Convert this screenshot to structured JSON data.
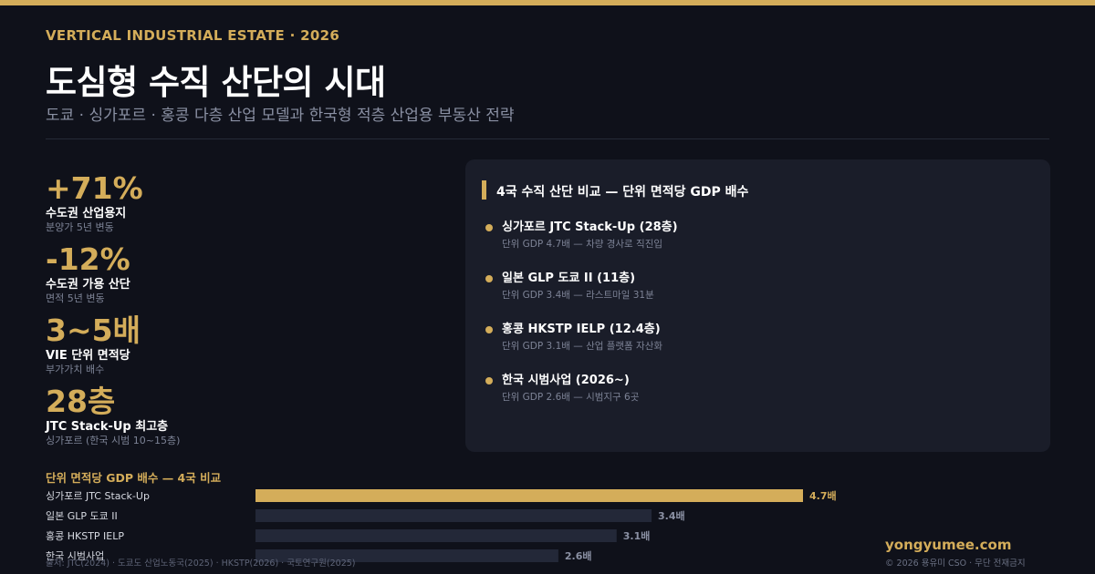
{
  "header": {
    "kicker": "VERTICAL INDUSTRIAL ESTATE · 2026",
    "title": "도심형 수직 산단의 시대",
    "subtitle": "도쿄 · 싱가포르 · 홍콩 다층 산업 모델과 한국형 적층 산업용 부동산 전략"
  },
  "stats": [
    {
      "value": "+71%",
      "label": "수도권 산업용지",
      "sub": "분양가 5년 변동"
    },
    {
      "value": "-12%",
      "label": "수도권 가용 산단",
      "sub": "면적 5년 변동"
    },
    {
      "value": "3~5배",
      "label": "VIE 단위 면적당",
      "sub": "부가가치 배수"
    },
    {
      "value": "28층",
      "label": "JTC Stack-Up 최고층",
      "sub": "싱가포르 (한국 시범 10~15층)"
    }
  ],
  "panel": {
    "title": "4국 수직 산단 비교 — 단위 면적당 GDP 배수",
    "items": [
      {
        "title": "싱가포르 JTC Stack-Up (28층)",
        "sub": "단위 GDP 4.7배 — 차량 경사로 직진입"
      },
      {
        "title": "일본 GLP 도쿄 II (11층)",
        "sub": "단위 GDP 3.4배 — 라스트마일 31분"
      },
      {
        "title": "홍콩 HKSTP IELP (12.4층)",
        "sub": "단위 GDP 3.1배 — 산업 플랫폼 자산화"
      },
      {
        "title": "한국 시범사업 (2026~)",
        "sub": "단위 GDP 2.6배 — 시범지구 6곳"
      }
    ]
  },
  "chart_data": {
    "type": "bar",
    "orientation": "horizontal",
    "title": "단위 면적당 GDP 배수 — 4국 비교",
    "categories": [
      "싱가포르 JTC Stack-Up",
      "일본 GLP 도쿄 II",
      "홍콩 HKSTP IELP",
      "한국 시범사업"
    ],
    "values": [
      4.7,
      3.4,
      3.1,
      2.6
    ],
    "value_labels": [
      "4.7배",
      "3.4배",
      "3.1배",
      "2.6배"
    ],
    "xlim": [
      0,
      4.7
    ],
    "grid": false,
    "colors": {
      "highlight": "#d4ad5a",
      "default": "#232838",
      "label_highlight": "#d4ad5a",
      "label_default": "#8a90a3"
    }
  },
  "footer": {
    "source": "출처: JTC(2024) · 도쿄도 산업노동국(2025) · HKSTP(2026) · 국토연구원(2025)",
    "brand": "yongyumee.com",
    "copyright": "© 2026 용유미 CSO · 무단 전재금지"
  },
  "colors": {
    "accent": "#d4ad5a",
    "background": "#0f111a",
    "panel": "#1a1d29"
  }
}
